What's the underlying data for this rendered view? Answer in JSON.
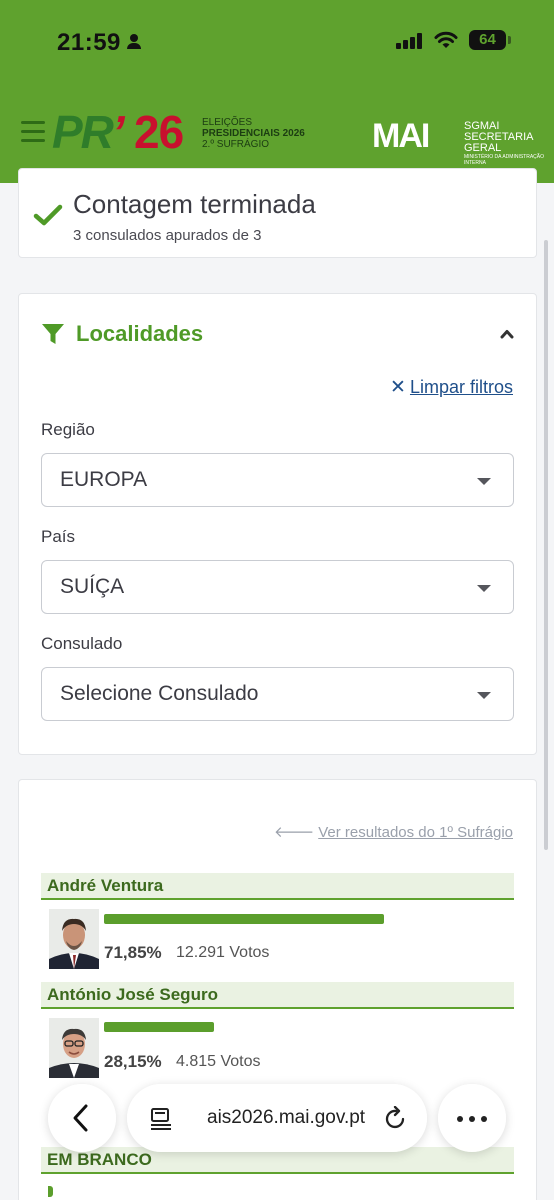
{
  "status_bar": {
    "time": "21:59",
    "battery": "64"
  },
  "header": {
    "logo_pr": "PR",
    "logo_tick": "’",
    "logo_year": "26",
    "logo_line1": "ELEIÇÕES",
    "logo_line2": "PRESIDENCIAIS 2026",
    "logo_line3": "2.º SUFRÁGIO",
    "partner_logo": "MAI",
    "partner_line1": "SGMAI",
    "partner_line2": "SECRETARIA",
    "partner_line3": "GERAL",
    "partner_line4": "MINISTÉRIO DA ADMINISTRAÇÃO INTERNA"
  },
  "count_status": {
    "title": "Contagem terminada",
    "subtitle": "3 consulados apurados de 3"
  },
  "filters": {
    "title": "Localidades",
    "clear_label": "Limpar filtros",
    "region_label": "Região",
    "region_value": "EUROPA",
    "country_label": "País",
    "country_value": "SUÍÇA",
    "consulate_label": "Consulado",
    "consulate_value": "Selecione Consulado"
  },
  "results": {
    "first_round_link": "Ver resultados do 1º Sufrágio",
    "candidates": [
      {
        "name": "André Ventura",
        "percent_label": "71,85%",
        "percent": 71.85,
        "votes": "12.291 Votos"
      },
      {
        "name": "António José Seguro",
        "percent_label": "28,15%",
        "percent": 28.15,
        "votes": "4.815 Votos"
      }
    ],
    "blank_label": "EM BRANCO"
  },
  "browser": {
    "url": "ais2026.mai.gov.pt"
  },
  "colors": {
    "brand_green": "#5fa22e",
    "bar_green": "#5b9e2c",
    "link_blue": "#1f4f8a"
  }
}
